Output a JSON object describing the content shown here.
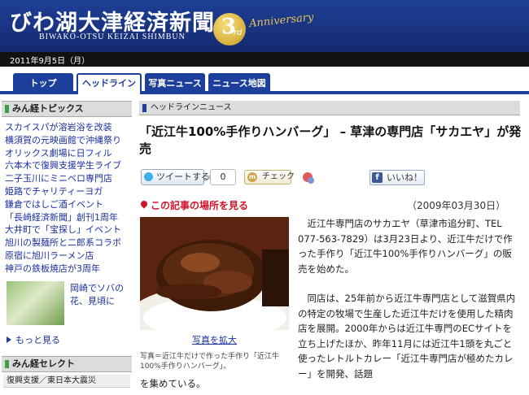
{
  "header": {
    "logo_main": "びわ湖大津経済新聞",
    "logo_sub": "BIWAKO-OTSU KEIZAI SHIMBUN",
    "anniversary_number": "3",
    "anniversary_suffix": "rd",
    "anniversary_text": "Anniversary"
  },
  "date_bar": {
    "date": "2011年9月5日（月）"
  },
  "nav": {
    "tabs": [
      {
        "label": "トップ"
      },
      {
        "label": "ヘッドライン"
      },
      {
        "label": "写真ニュース"
      },
      {
        "label": "ニュース地図"
      }
    ],
    "active_tab": "ヘッドライン"
  },
  "sidebar": {
    "topics_heading": "みん経トピックス",
    "topics": [
      "スカイスパが溶岩浴を改装",
      "横須賀の元映画館で沖縄祭り",
      "オリックス劇場に日フィル",
      "六本木で復興支援学生ライブ",
      "二子玉川にミニベロ専門店",
      "姫路でチャリティーヨガ",
      "鎌倉ではしご酒イベント",
      "「長崎経済新聞」創刊1周年",
      "大井町で「宝探し」イベント",
      "旭川の製麺所と二郎系コラボ",
      "原宿に旭川ラーメン店",
      "神戸の鉄板焼店が3周年"
    ],
    "thumb_caption": "岡崎でソバの花、見頃に",
    "more_label": "もっと見る",
    "select_heading": "みん経セレクト",
    "select_items": [
      "復興支援／東日本大震災"
    ]
  },
  "article": {
    "section_heading": "ヘッドラインニュース",
    "title": "「近江牛100%手作りハンバーグ」 – 草津の専門店「サカエヤ」が発売",
    "share": {
      "tweet_label": "ツイートする",
      "tweet_count": "0",
      "mixi_icon": "m",
      "mixi_label": "チェック",
      "facebook_icon": "f",
      "facebook_label": "いいね！"
    },
    "location_link": "この記事の場所を見る",
    "published": "（2009年03月30日）",
    "photo_link": "写真を拡大",
    "photo_caption": "写真＝近江牛だけで作った手作り「近江牛100%手作りハンバーグ」。",
    "paragraph1": "近江牛専門店のサカエヤ（草津市追分町、TEL 077-563-7829）は3月23日より、近江牛だけで作った手作り「近江牛100%手作りハンバーグ」の販売を始めた。",
    "paragraph2": "同店は、25年前から近江牛専門店として滋賀県内の特定の牧場で生産した近江牛だけを使用した精肉店を展開。2000年からは近江牛専門のECサイトを立ち上げたほか、昨年11月には近江牛1頭を丸ごと使ったレトルトカレー「近江牛専門店が極めたカレー」を開発、話題",
    "paragraph2_tail": "を集めている。"
  },
  "colors": {
    "header_blue": "#1f3f96",
    "nav_blue": "#1c3f9c",
    "link_blue": "#1a2fa0",
    "alert_red": "#d0142a",
    "gold": "#e6c35a"
  }
}
